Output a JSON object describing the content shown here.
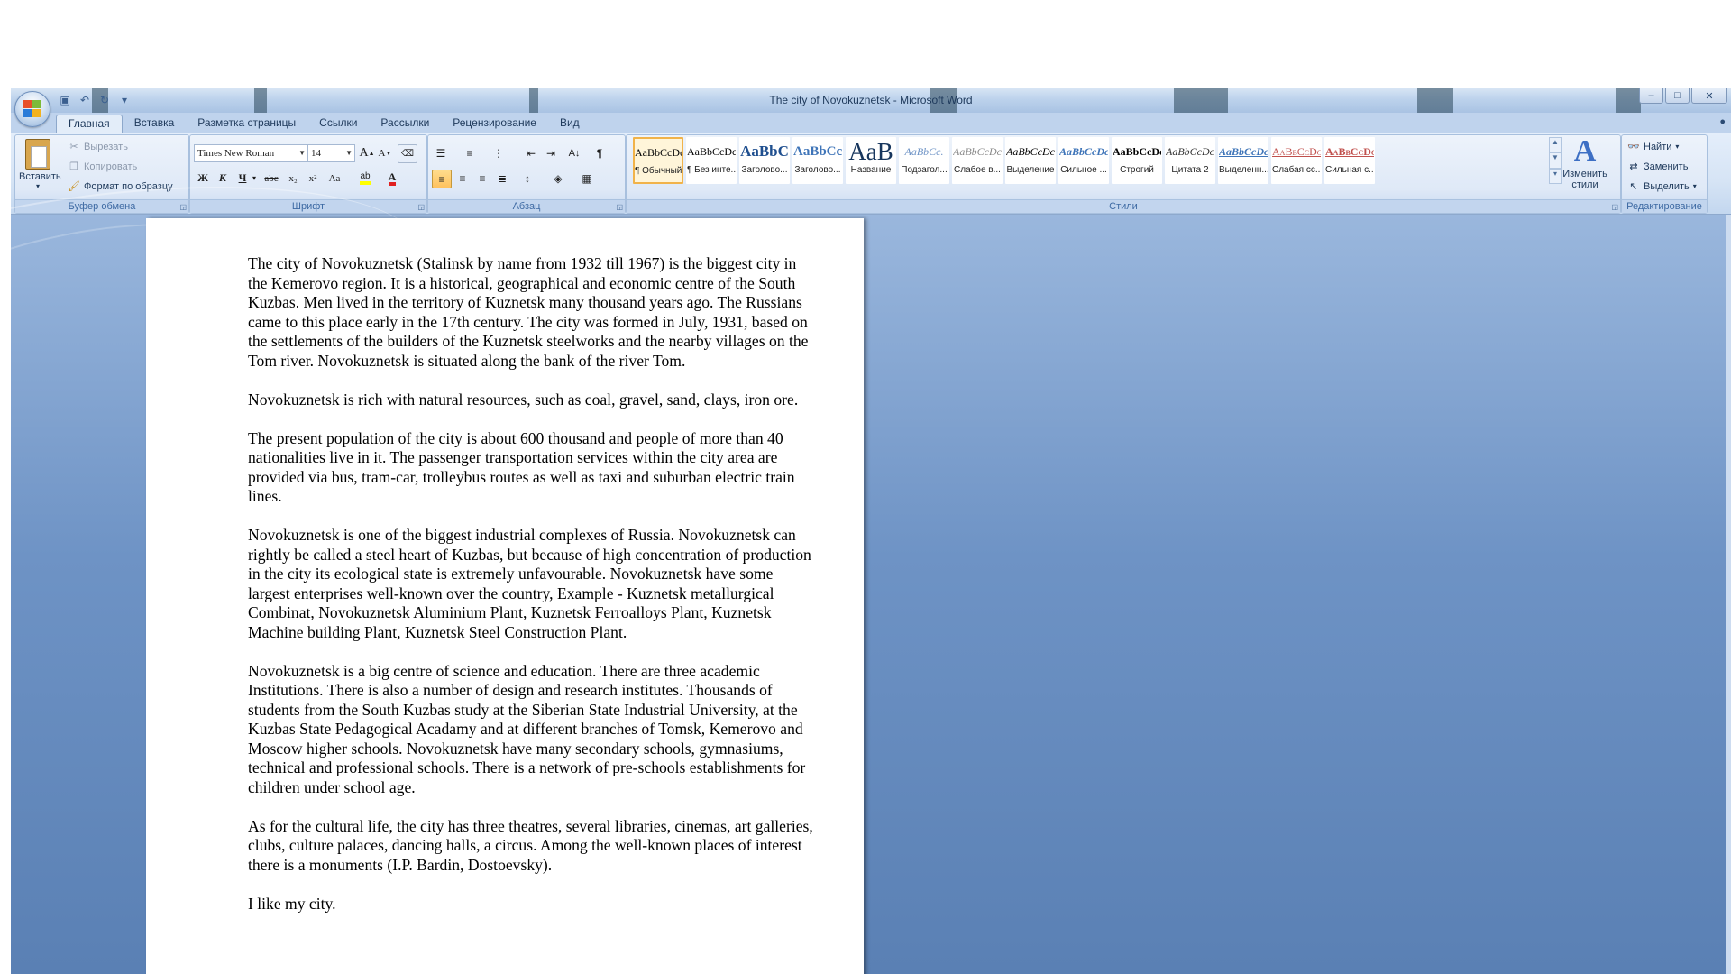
{
  "window": {
    "title": "The city of Novokuznetsk - Microsoft Word",
    "controls": {
      "minimize": "–",
      "maximize": "□",
      "close": "✕"
    }
  },
  "quick_access": [
    "save-icon",
    "undo-icon",
    "redo-icon",
    "customize-icon"
  ],
  "tabs": [
    {
      "label": "Главная",
      "active": true
    },
    {
      "label": "Вставка"
    },
    {
      "label": "Разметка страницы"
    },
    {
      "label": "Ссылки"
    },
    {
      "label": "Рассылки"
    },
    {
      "label": "Рецензирование"
    },
    {
      "label": "Вид"
    }
  ],
  "ribbon": {
    "clipboard": {
      "label": "Буфер обмена",
      "paste": "Вставить",
      "cut": "Вырезать",
      "copy": "Копировать",
      "format_painter": "Формат по образцу"
    },
    "font": {
      "label": "Шрифт",
      "font_name": "Times New Roman",
      "font_size": "14",
      "bold": "Ж",
      "italic": "К",
      "underline": "Ч",
      "strike": "abc",
      "subscript": "x₂",
      "superscript": "x²",
      "case": "Aa",
      "grow": "A",
      "shrink": "A",
      "highlight_color": "#ffff00",
      "font_color": "#e02020"
    },
    "paragraph": {
      "label": "Абзац"
    },
    "styles": {
      "label": "Стили",
      "items": [
        {
          "preview": "AaBbCcDc",
          "name": "¶ Обычный",
          "selected": true
        },
        {
          "preview": "AaBbCcDc",
          "name": "¶ Без инте..."
        },
        {
          "preview": "AaBbC",
          "name": "Заголово..."
        },
        {
          "preview": "AaBbCc",
          "name": "Заголово..."
        },
        {
          "preview": "AaB",
          "name": "Название"
        },
        {
          "preview": "AaBbCc.",
          "name": "Подзагол..."
        },
        {
          "preview": "AaBbCcDc",
          "name": "Слабое в..."
        },
        {
          "preview": "AaBbCcDc",
          "name": "Выделение"
        },
        {
          "preview": "AaBbCcDc",
          "name": "Сильное ..."
        },
        {
          "preview": "AaBbCcDc",
          "name": "Строгий"
        },
        {
          "preview": "AaBbCcDc",
          "name": "Цитата 2"
        },
        {
          "preview": "AaBbCcDc",
          "name": "Выделенн..."
        },
        {
          "preview": "AaBbCcDc",
          "name": "Слабая сс..."
        },
        {
          "preview": "AaBbCcDc",
          "name": "Сильная с..."
        }
      ],
      "change_styles": "Изменить стили"
    },
    "editing": {
      "label": "Редактирование",
      "find": "Найти",
      "replace": "Заменить",
      "select": "Выделить"
    }
  },
  "document": {
    "paragraphs": [
      "The city of Novokuznetsk (Stalinsk by name from 1932 till 1967) is the biggest city in the Kemerovo region. It is a historical, geographical and economic centre of the South Kuzbas. Men lived in the territory of Kuznetsk many thousand years ago. The Russians came to this place early in the 17th century. The city was formed in July, 1931, based on the settlements of the builders of the Kuznetsk steelworks and the nearby villages on the Tom river. Novokuznetsk is situated along the bank of the river Tom.",
      "Novokuznetsk is rich with natural resources, such as coal, gravel, sand, clays, iron ore.",
      "The present population of the city is about 600 thousand and people of more than 40 nationalities live in it. The passenger transportation services within the city area are provided via bus, tram-car, trolleybus routes as well as taxi and suburban electric train lines.",
      "Novokuznetsk is one of the biggest industrial complexes of Russia. Novokuznetsk can rightly be called a steel heart of Kuzbas, but because of high concentration of production in the city its ecological state is extremely unfavourable. Novokuznetsk have some largest enterprises well-known over the country, Example - Kuznetsk metallurgical Combinat, Novokuznetsk Aluminium Plant, Kuznetsk Ferroalloys Plant, Kuznetsk Machine building Plant, Kuznetsk Steel Construction Plant.",
      "Novokuznetsk is a big centre of science and education. There are three academic Institutions. There is also a number of design and research institutes. Thousands of students from the South Kuzbas study at the Siberian State Industrial University, at the Kuzbas State Pedagogical Acadamy and at different branches of Tomsk, Kemerovo and Moscow higher schools. Novokuznetsk have many secondary schools, gymnasiums, technical and professional schools. There is a network of pre-schools establishments for children under school age.",
      "As for the cultural life, the city has three theatres, several libraries, cinemas, art galleries, clubs, culture palaces, dancing halls, a circus. Among the well-known places of interest there is a monuments (I.P. Bardin, Dostoevsky).",
      "I like my city."
    ]
  }
}
